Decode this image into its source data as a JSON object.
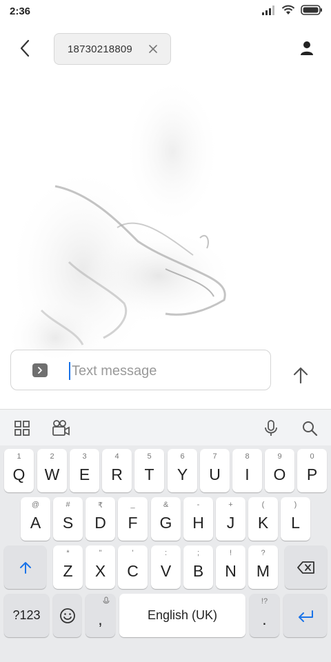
{
  "status_bar": {
    "time": "2:36"
  },
  "header": {
    "recipient": "18730218809"
  },
  "compose": {
    "placeholder": "Text message"
  },
  "keyboard": {
    "row1": [
      {
        "hint": "1",
        "label": "Q"
      },
      {
        "hint": "2",
        "label": "W"
      },
      {
        "hint": "3",
        "label": "E"
      },
      {
        "hint": "4",
        "label": "R"
      },
      {
        "hint": "5",
        "label": "T"
      },
      {
        "hint": "6",
        "label": "Y"
      },
      {
        "hint": "7",
        "label": "U"
      },
      {
        "hint": "8",
        "label": "I"
      },
      {
        "hint": "9",
        "label": "O"
      },
      {
        "hint": "0",
        "label": "P"
      }
    ],
    "row2": [
      {
        "hint": "@",
        "label": "A"
      },
      {
        "hint": "#",
        "label": "S"
      },
      {
        "hint": "₹",
        "label": "D"
      },
      {
        "hint": "_",
        "label": "F"
      },
      {
        "hint": "&",
        "label": "G"
      },
      {
        "hint": "-",
        "label": "H"
      },
      {
        "hint": "+",
        "label": "J"
      },
      {
        "hint": "(",
        "label": "K"
      },
      {
        "hint": ")",
        "label": "L"
      }
    ],
    "row3": [
      {
        "hint": "*",
        "label": "Z"
      },
      {
        "hint": "\"",
        "label": "X"
      },
      {
        "hint": "'",
        "label": "C"
      },
      {
        "hint": ":",
        "label": "V"
      },
      {
        "hint": ";",
        "label": "B"
      },
      {
        "hint": "!",
        "label": "N"
      },
      {
        "hint": "?",
        "label": "M"
      }
    ],
    "symbols_label": "?123",
    "comma_label": ",",
    "space_label": "English (UK)",
    "period_hint": "!?",
    "period_label": "."
  },
  "colors": {
    "accent": "#1a73e8",
    "keyboard_bg": "#e9eaec"
  }
}
